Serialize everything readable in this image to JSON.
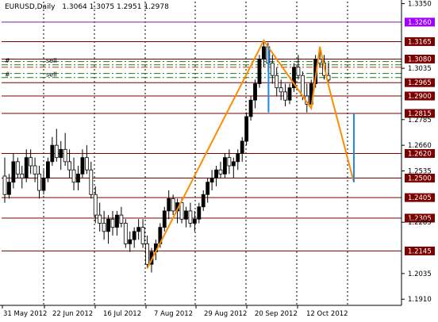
{
  "header": {
    "symbol": "EURUSD,Daily",
    "ohlc": "1.3064 1.3075 1.2951 1.2978"
  },
  "chart_data": {
    "type": "candlestick",
    "price_axis": {
      "labels": [
        "1.3350",
        "1.3260",
        "1.3165",
        "1.3080",
        "1.3035",
        "1.2965",
        "1.2900",
        "1.2815",
        "1.2785",
        "1.2660",
        "1.2620",
        "1.2535",
        "1.2500",
        "1.2405",
        "1.2305",
        "1.2285",
        "1.2145",
        "1.2035",
        "1.1910"
      ],
      "plain": [
        "1.3350",
        "1.3035",
        "1.2785",
        "1.2660",
        "1.2535",
        "1.2285",
        "1.2035",
        "1.1910"
      ]
    },
    "time_axis": {
      "labels": [
        "31 May 2012",
        "22 Jun 2012",
        "16 Jul 2012",
        "7 Aug 2012",
        "29 Aug 2012",
        "20 Sep 2012",
        "12 Oct 2012"
      ]
    },
    "levels": [
      {
        "price": "1.3260",
        "color": "#7b1fa2",
        "label_bg": "#a000ff"
      },
      {
        "price": "1.3165",
        "color": "#7b0000",
        "label_bg": "#7b0000"
      },
      {
        "price": "1.3080",
        "color": "#7b0000",
        "label_bg": "#7b0000"
      },
      {
        "price": "1.2965",
        "color": "#7b0000",
        "label_bg": "#7b0000"
      },
      {
        "price": "1.2900",
        "color": "#7b0000",
        "label_bg": "#7b0000"
      },
      {
        "price": "1.2815",
        "color": "#7b0000",
        "label_bg": "#7b0000"
      },
      {
        "price": "1.2620",
        "color": "#7b0000",
        "label_bg": "#7b0000"
      },
      {
        "price": "1.2500",
        "color": "#7b0000",
        "label_bg": "#7b0000"
      },
      {
        "price": "1.2405",
        "color": "#7b0000",
        "label_bg": "#7b0000"
      },
      {
        "price": "1.2305",
        "color": "#7b0000",
        "label_bg": "#7b0000"
      },
      {
        "price": "1.2145",
        "color": "#7b0000",
        "label_bg": "#7b0000"
      }
    ],
    "orders": [
      {
        "marker": "#",
        "label": "sell"
      },
      {
        "marker": "#",
        "label": "sell"
      }
    ],
    "candles": [
      [
        1.251,
        1.26,
        1.238,
        1.242
      ],
      [
        1.242,
        1.252,
        1.24,
        1.248
      ],
      [
        1.248,
        1.262,
        1.245,
        1.258
      ],
      [
        1.258,
        1.26,
        1.25,
        1.252
      ],
      [
        1.252,
        1.256,
        1.245,
        1.25
      ],
      [
        1.25,
        1.264,
        1.248,
        1.26
      ],
      [
        1.26,
        1.264,
        1.252,
        1.256
      ],
      [
        1.256,
        1.26,
        1.248,
        1.252
      ],
      [
        1.252,
        1.256,
        1.24,
        1.244
      ],
      [
        1.244,
        1.254,
        1.242,
        1.25
      ],
      [
        1.25,
        1.26,
        1.248,
        1.258
      ],
      [
        1.258,
        1.27,
        1.256,
        1.266
      ],
      [
        1.266,
        1.274,
        1.258,
        1.26
      ],
      [
        1.26,
        1.268,
        1.254,
        1.264
      ],
      [
        1.264,
        1.272,
        1.256,
        1.258
      ],
      [
        1.258,
        1.264,
        1.25,
        1.254
      ],
      [
        1.254,
        1.26,
        1.244,
        1.248
      ],
      [
        1.248,
        1.256,
        1.244,
        1.252
      ],
      [
        1.252,
        1.264,
        1.25,
        1.26
      ],
      [
        1.26,
        1.266,
        1.252,
        1.254
      ],
      [
        1.254,
        1.258,
        1.24,
        1.242
      ],
      [
        1.242,
        1.246,
        1.228,
        1.232
      ],
      [
        1.232,
        1.238,
        1.224,
        1.228
      ],
      [
        1.228,
        1.234,
        1.22,
        1.224
      ],
      [
        1.224,
        1.232,
        1.218,
        1.23
      ],
      [
        1.23,
        1.234,
        1.222,
        1.226
      ],
      [
        1.226,
        1.234,
        1.222,
        1.232
      ],
      [
        1.232,
        1.236,
        1.226,
        1.228
      ],
      [
        1.228,
        1.23,
        1.216,
        1.218
      ],
      [
        1.218,
        1.224,
        1.214,
        1.22
      ],
      [
        1.22,
        1.226,
        1.216,
        1.224
      ],
      [
        1.224,
        1.23,
        1.22,
        1.226
      ],
      [
        1.226,
        1.23,
        1.216,
        1.218
      ],
      [
        1.218,
        1.222,
        1.206,
        1.208
      ],
      [
        1.208,
        1.216,
        1.204,
        1.214
      ],
      [
        1.214,
        1.22,
        1.21,
        1.218
      ],
      [
        1.218,
        1.228,
        1.216,
        1.226
      ],
      [
        1.226,
        1.236,
        1.224,
        1.234
      ],
      [
        1.234,
        1.244,
        1.23,
        1.24
      ],
      [
        1.24,
        1.242,
        1.232,
        1.234
      ],
      [
        1.234,
        1.24,
        1.228,
        1.238
      ],
      [
        1.238,
        1.24,
        1.228,
        1.23
      ],
      [
        1.23,
        1.236,
        1.226,
        1.234
      ],
      [
        1.234,
        1.238,
        1.226,
        1.228
      ],
      [
        1.228,
        1.234,
        1.224,
        1.23
      ],
      [
        1.23,
        1.238,
        1.228,
        1.236
      ],
      [
        1.236,
        1.244,
        1.234,
        1.242
      ],
      [
        1.242,
        1.25,
        1.238,
        1.248
      ],
      [
        1.248,
        1.254,
        1.244,
        1.25
      ],
      [
        1.25,
        1.256,
        1.246,
        1.254
      ],
      [
        1.254,
        1.258,
        1.25,
        1.252
      ],
      [
        1.252,
        1.262,
        1.25,
        1.26
      ],
      [
        1.26,
        1.264,
        1.252,
        1.256
      ],
      [
        1.256,
        1.26,
        1.25,
        1.258
      ],
      [
        1.258,
        1.264,
        1.254,
        1.262
      ],
      [
        1.262,
        1.27,
        1.258,
        1.268
      ],
      [
        1.268,
        1.282,
        1.266,
        1.28
      ],
      [
        1.28,
        1.29,
        1.278,
        1.288
      ],
      [
        1.288,
        1.298,
        1.284,
        1.296
      ],
      [
        1.296,
        1.31,
        1.294,
        1.308
      ],
      [
        1.308,
        1.317,
        1.304,
        1.314
      ],
      [
        1.314,
        1.316,
        1.302,
        1.306
      ],
      [
        1.306,
        1.31,
        1.296,
        1.3
      ],
      [
        1.3,
        1.304,
        1.29,
        1.294
      ],
      [
        1.294,
        1.298,
        1.288,
        1.292
      ],
      [
        1.292,
        1.296,
        1.285,
        1.288
      ],
      [
        1.288,
        1.296,
        1.286,
        1.294
      ],
      [
        1.294,
        1.306,
        1.292,
        1.304
      ],
      [
        1.304,
        1.31,
        1.298,
        1.3
      ],
      [
        1.3,
        1.302,
        1.288,
        1.29
      ],
      [
        1.29,
        1.296,
        1.282,
        1.286
      ],
      [
        1.286,
        1.298,
        1.284,
        1.296
      ],
      [
        1.296,
        1.31,
        1.294,
        1.308
      ],
      [
        1.308,
        1.314,
        1.304,
        1.306
      ],
      [
        1.306,
        1.31,
        1.298,
        1.3
      ],
      [
        1.3,
        1.3064,
        1.2951,
        1.2978
      ]
    ]
  }
}
